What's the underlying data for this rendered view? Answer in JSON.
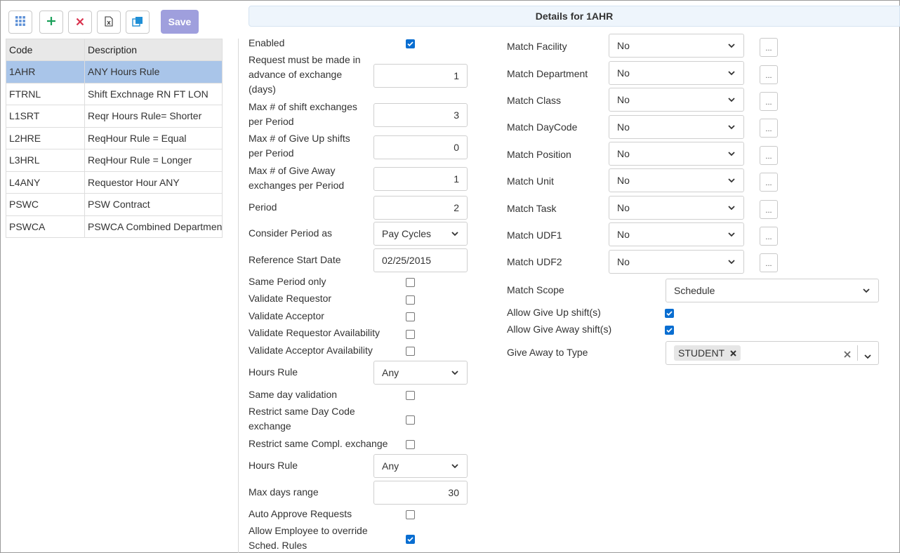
{
  "toolbar": {
    "buttons": [
      {
        "icon": "grid-icon",
        "color": "#5b8fd6"
      },
      {
        "icon": "plus-icon",
        "color": "#1aa05a"
      },
      {
        "icon": "close-icon",
        "color": "#d9314d"
      },
      {
        "icon": "excel-export-icon",
        "color": "#333333"
      },
      {
        "icon": "copy-icon",
        "color": "#1f8fd6"
      }
    ],
    "save_label": "Save"
  },
  "list": {
    "headers": {
      "code": "Code",
      "description": "Description"
    },
    "rows": [
      {
        "code": "1AHR",
        "description": "ANY Hours Rule",
        "selected": true
      },
      {
        "code": "FTRNL",
        "description": "Shift Exchnage RN FT LON"
      },
      {
        "code": "L1SRT",
        "description": "Reqr Hours Rule= Shorter"
      },
      {
        "code": "L2HRE",
        "description": "ReqHour Rule = Equal"
      },
      {
        "code": "L3HRL",
        "description": "ReqHour Rule = Longer"
      },
      {
        "code": "L4ANY",
        "description": "Requestor Hour ANY"
      },
      {
        "code": "PSWC",
        "description": "PSW Contract"
      },
      {
        "code": "PSWCA",
        "description": "PSWCA Combined Departmen"
      }
    ]
  },
  "details": {
    "title": "Details for 1AHR",
    "left": {
      "enabled": {
        "label": "Enabled",
        "checked": true
      },
      "advance_days": {
        "label_lines": [
          "Request must be made in",
          "advance of exchange",
          "(days)"
        ],
        "value": "1"
      },
      "max_shift_exchanges": {
        "label_lines": [
          "Max # of shift exchanges",
          "per Period"
        ],
        "value": "3"
      },
      "max_give_up": {
        "label_lines": [
          "Max # of Give Up shifts",
          "per Period"
        ],
        "value": "0"
      },
      "max_give_away": {
        "label_lines": [
          "Max # of Give Away",
          "exchanges per Period"
        ],
        "value": "1"
      },
      "period": {
        "label": "Period",
        "value": "2"
      },
      "consider_period": {
        "label": "Consider Period as",
        "value": "Pay Cycles"
      },
      "reference_start": {
        "label": "Reference Start Date",
        "value": "02/25/2015"
      },
      "same_period_only": {
        "label": "Same Period only",
        "checked": false
      },
      "validate_requestor": {
        "label": "Validate Requestor",
        "checked": false
      },
      "validate_acceptor": {
        "label": "Validate Acceptor",
        "checked": false
      },
      "validate_requestor_avail": {
        "label": "Validate Requestor Availability",
        "checked": false
      },
      "validate_acceptor_avail": {
        "label": "Validate Acceptor Availability",
        "checked": false
      },
      "hours_rule_1": {
        "label": "Hours Rule",
        "value": "Any"
      },
      "same_day_validation": {
        "label": "Same day validation",
        "checked": false
      },
      "restrict_day_code": {
        "label_lines": [
          "Restrict same Day Code",
          "exchange"
        ],
        "checked": false
      },
      "restrict_compl": {
        "label": "Restrict same Compl. exchange",
        "checked": false
      },
      "hours_rule_2": {
        "label": "Hours Rule",
        "value": "Any"
      },
      "max_days_range": {
        "label": "Max days range",
        "value": "30"
      },
      "auto_approve": {
        "label": "Auto Approve Requests",
        "checked": false
      },
      "allow_override": {
        "label_lines": [
          "Allow Employee to override",
          "Sched. Rules"
        ],
        "checked": true
      }
    },
    "right": {
      "matches": [
        {
          "label": "Match Facility",
          "value": "No"
        },
        {
          "label": "Match Department",
          "value": "No"
        },
        {
          "label": "Match Class",
          "value": "No"
        },
        {
          "label": "Match DayCode",
          "value": "No"
        },
        {
          "label": "Match Position",
          "value": "No"
        },
        {
          "label": "Match Unit",
          "value": "No"
        },
        {
          "label": "Match Task",
          "value": "No"
        },
        {
          "label": "Match UDF1",
          "value": "No"
        },
        {
          "label": "Match UDF2",
          "value": "No"
        }
      ],
      "more_button_label": "...",
      "match_scope": {
        "label": "Match Scope",
        "value": "Schedule"
      },
      "allow_give_up": {
        "label": "Allow Give Up shift(s)",
        "checked": true
      },
      "allow_give_away": {
        "label": "Allow Give Away shift(s)",
        "checked": true
      },
      "give_away_type": {
        "label": "Give Away to Type",
        "tags": [
          "STUDENT"
        ]
      }
    }
  }
}
